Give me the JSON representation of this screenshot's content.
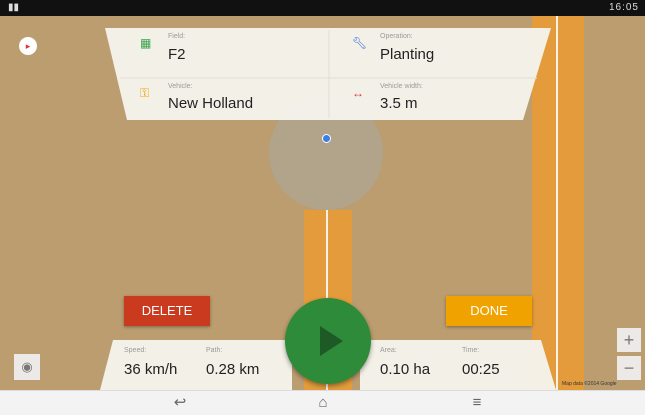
{
  "status_bar": {
    "left_icon": "app-icon",
    "right_text": "16:05"
  },
  "info": {
    "field_label": "Field:",
    "field_value": "F2",
    "operation_label": "Operation:",
    "operation_value": "Planting",
    "vehicle_label": "Vehicle:",
    "vehicle_value": "New Holland",
    "width_label": "Vehicle width:",
    "width_value": "3.5 m"
  },
  "buttons": {
    "delete": "DELETE",
    "done": "DONE"
  },
  "stats": {
    "speed_label": "Speed:",
    "speed_value": "36 km/h",
    "path_label": "Path:",
    "path_value": "0.28 km",
    "area_label": "Area:",
    "area_value": "0.10 ha",
    "time_label": "Time:",
    "time_value": "00:25"
  },
  "zoom": {
    "in": "+",
    "out": "−"
  },
  "map_credit": "Map data ©2014 Google",
  "colors": {
    "delete": "#c93a1f",
    "done": "#f0a200",
    "play": "#2e8b3a",
    "stripe": "#e39b3c"
  }
}
